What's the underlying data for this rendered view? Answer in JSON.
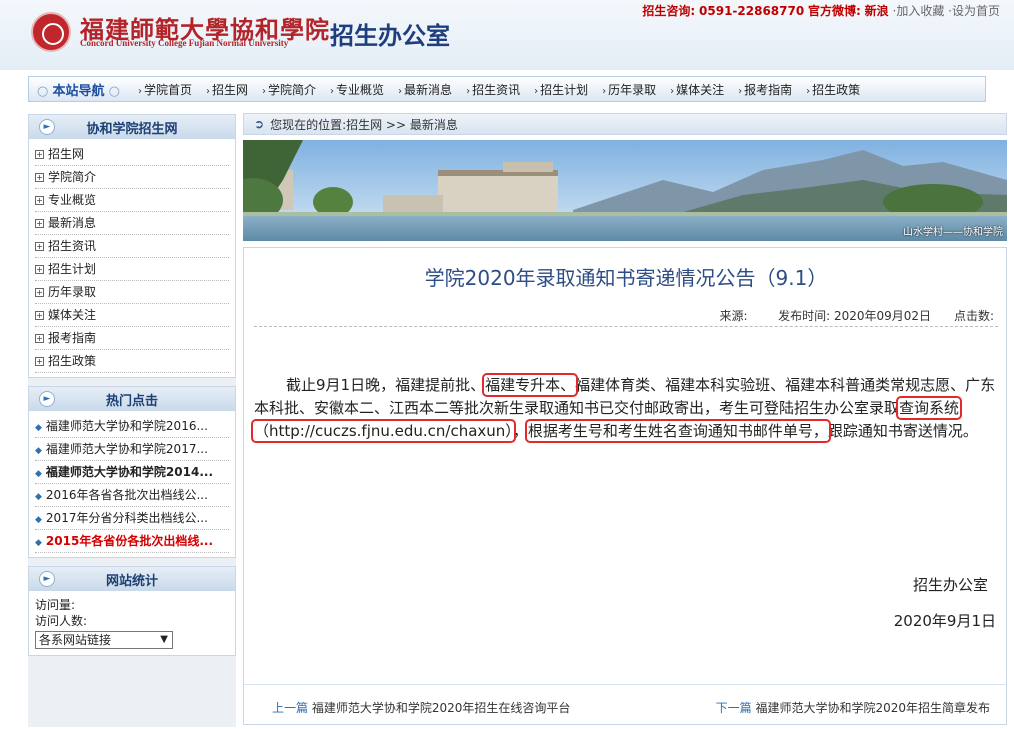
{
  "header": {
    "logo_cn": "福建師範大學協和學院",
    "logo_en": "Concord University College Fujian Normal University",
    "office": "招生办公室",
    "hotline_label": "招生咨询:",
    "hotline": "0591-22868770",
    "weibo_label": "官方微博:",
    "weibo": "新浪",
    "favorite": "·加入收藏",
    "homepage": "·设为首页"
  },
  "nav": {
    "title": "本站导航",
    "items": [
      "学院首页",
      "招生网",
      "学院简介",
      "专业概览",
      "最新消息",
      "招生资讯",
      "招生计划",
      "历年录取",
      "媒体关注",
      "报考指南",
      "招生政策"
    ]
  },
  "sidebar": {
    "site_title": "协和学院招生网",
    "links": [
      "招生网",
      "学院简介",
      "专业概览",
      "最新消息",
      "招生资讯",
      "招生计划",
      "历年录取",
      "媒体关注",
      "报考指南",
      "招生政策"
    ],
    "hot_title": "热门点击",
    "hot": [
      "福建师范大学协和学院2016...",
      "福建师范大学协和学院2017...",
      "福建师范大学协和学院2014...",
      "2016年各省各批次出档线公...",
      "2017年分省分科类出档线公...",
      "2015年各省份各批次出档线..."
    ],
    "stats_title": "网站统计",
    "visits_label": "访问量:",
    "visitors_label": "访问人数:",
    "select_value": "各系网站链接"
  },
  "breadcrumb": {
    "prefix": "您现在的位置:",
    "path": "招生网 >> 最新消息"
  },
  "banner": {
    "caption": "山水学村——协和学院"
  },
  "article": {
    "title": "学院2020年录取通知书寄递情况公告（9.1）",
    "source_label": "来源:",
    "date_label": "发布时间:",
    "date": "2020年09月02日",
    "clicks_label": "点击数:",
    "p1": "截止9月1日晚，福建提前批、",
    "h1": "福建专升本、",
    "p2": "福建体育类、福建本科实验班、福建本科普通类常规志愿、广东本科批、安徽本二、江西本二等批次新生录取通知书已交付邮政寄出，考生可登陆招生办公室录取",
    "h2": "查询系统（http://cuczs.fjnu.edu.cn/chaxun）",
    "p3": "，",
    "h3": "根据考生号和考生姓名查询通知书邮件单号，",
    "p4": "跟踪通知书寄送情况。",
    "signature": "招生办公室",
    "sign_date": "2020年9月1日"
  },
  "footer": {
    "prev_label": "上一篇",
    "prev_title": "福建师范大学协和学院2020年招生在线咨询平台",
    "next_label": "下一篇",
    "next_title": "福建师范大学协和学院2020年招生简章发布"
  }
}
